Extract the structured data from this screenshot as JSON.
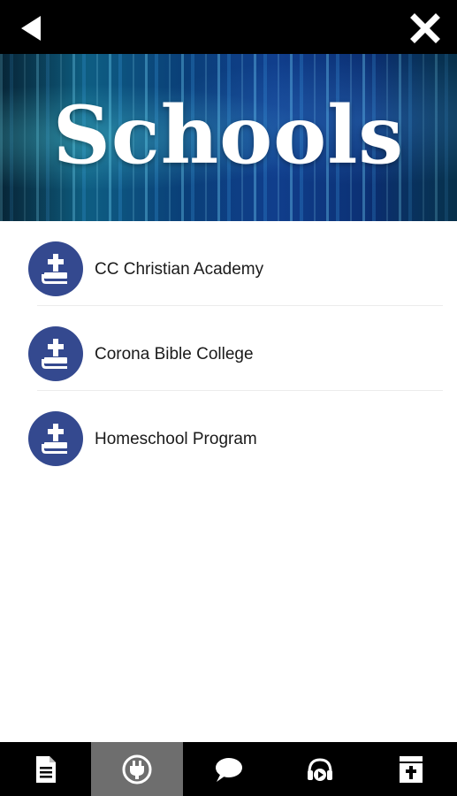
{
  "header": {
    "back_icon": "back-arrow-icon",
    "close_icon": "close-icon"
  },
  "banner": {
    "title": "Schools"
  },
  "list": {
    "items": [
      {
        "label": "CC Christian Academy",
        "icon": "bible-cross-icon"
      },
      {
        "label": "Corona Bible College",
        "icon": "bible-cross-icon"
      },
      {
        "label": "Homeschool Program",
        "icon": "bible-cross-icon"
      }
    ]
  },
  "tabs": [
    {
      "icon": "document-icon",
      "active": false
    },
    {
      "icon": "plug-icon",
      "active": true
    },
    {
      "icon": "chat-bubble-icon",
      "active": false
    },
    {
      "icon": "headphones-play-icon",
      "active": false
    },
    {
      "icon": "bible-icon",
      "active": false
    }
  ],
  "colors": {
    "bar": "#000000",
    "accent": "#34498f",
    "active_tab": "#6e6e6e"
  }
}
